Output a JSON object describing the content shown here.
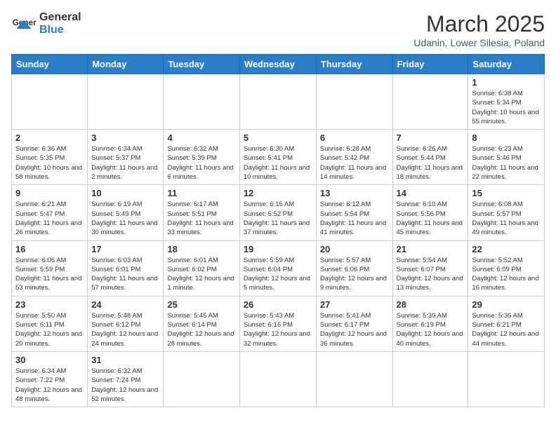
{
  "header": {
    "logo_general": "General",
    "logo_blue": "Blue",
    "month_title": "March 2025",
    "subtitle": "Udanin, Lower Silesia, Poland"
  },
  "weekdays": [
    "Sunday",
    "Monday",
    "Tuesday",
    "Wednesday",
    "Thursday",
    "Friday",
    "Saturday"
  ],
  "weeks": [
    [
      {
        "day": "",
        "info": ""
      },
      {
        "day": "",
        "info": ""
      },
      {
        "day": "",
        "info": ""
      },
      {
        "day": "",
        "info": ""
      },
      {
        "day": "",
        "info": ""
      },
      {
        "day": "",
        "info": ""
      },
      {
        "day": "1",
        "info": "Sunrise: 6:38 AM\nSunset: 5:34 PM\nDaylight: 10 hours and 55 minutes."
      }
    ],
    [
      {
        "day": "2",
        "info": "Sunrise: 6:36 AM\nSunset: 5:35 PM\nDaylight: 10 hours and 58 minutes."
      },
      {
        "day": "3",
        "info": "Sunrise: 6:34 AM\nSunset: 5:37 PM\nDaylight: 11 hours and 2 minutes."
      },
      {
        "day": "4",
        "info": "Sunrise: 6:32 AM\nSunset: 5:39 PM\nDaylight: 11 hours and 6 minutes."
      },
      {
        "day": "5",
        "info": "Sunrise: 6:30 AM\nSunset: 5:41 PM\nDaylight: 11 hours and 10 minutes."
      },
      {
        "day": "6",
        "info": "Sunrise: 6:28 AM\nSunset: 5:42 PM\nDaylight: 11 hours and 14 minutes."
      },
      {
        "day": "7",
        "info": "Sunrise: 6:26 AM\nSunset: 5:44 PM\nDaylight: 11 hours and 18 minutes."
      },
      {
        "day": "8",
        "info": "Sunrise: 6:23 AM\nSunset: 5:46 PM\nDaylight: 11 hours and 22 minutes."
      }
    ],
    [
      {
        "day": "9",
        "info": "Sunrise: 6:21 AM\nSunset: 5:47 PM\nDaylight: 11 hours and 26 minutes."
      },
      {
        "day": "10",
        "info": "Sunrise: 6:19 AM\nSunset: 5:49 PM\nDaylight: 11 hours and 30 minutes."
      },
      {
        "day": "11",
        "info": "Sunrise: 6:17 AM\nSunset: 5:51 PM\nDaylight: 11 hours and 33 minutes."
      },
      {
        "day": "12",
        "info": "Sunrise: 6:15 AM\nSunset: 5:52 PM\nDaylight: 11 hours and 37 minutes."
      },
      {
        "day": "13",
        "info": "Sunrise: 6:12 AM\nSunset: 5:54 PM\nDaylight: 11 hours and 41 minutes."
      },
      {
        "day": "14",
        "info": "Sunrise: 6:10 AM\nSunset: 5:56 PM\nDaylight: 11 hours and 45 minutes."
      },
      {
        "day": "15",
        "info": "Sunrise: 6:08 AM\nSunset: 5:57 PM\nDaylight: 11 hours and 49 minutes."
      }
    ],
    [
      {
        "day": "16",
        "info": "Sunrise: 6:06 AM\nSunset: 5:59 PM\nDaylight: 11 hours and 53 minutes."
      },
      {
        "day": "17",
        "info": "Sunrise: 6:03 AM\nSunset: 6:01 PM\nDaylight: 11 hours and 57 minutes."
      },
      {
        "day": "18",
        "info": "Sunrise: 6:01 AM\nSunset: 6:02 PM\nDaylight: 12 hours and 1 minute."
      },
      {
        "day": "19",
        "info": "Sunrise: 5:59 AM\nSunset: 6:04 PM\nDaylight: 12 hours and 5 minutes."
      },
      {
        "day": "20",
        "info": "Sunrise: 5:57 AM\nSunset: 6:06 PM\nDaylight: 12 hours and 9 minutes."
      },
      {
        "day": "21",
        "info": "Sunrise: 5:54 AM\nSunset: 6:07 PM\nDaylight: 12 hours and 13 minutes."
      },
      {
        "day": "22",
        "info": "Sunrise: 5:52 AM\nSunset: 6:09 PM\nDaylight: 12 hours and 16 minutes."
      }
    ],
    [
      {
        "day": "23",
        "info": "Sunrise: 5:50 AM\nSunset: 6:11 PM\nDaylight: 12 hours and 20 minutes."
      },
      {
        "day": "24",
        "info": "Sunrise: 5:48 AM\nSunset: 6:12 PM\nDaylight: 12 hours and 24 minutes."
      },
      {
        "day": "25",
        "info": "Sunrise: 5:45 AM\nSunset: 6:14 PM\nDaylight: 12 hours and 28 minutes."
      },
      {
        "day": "26",
        "info": "Sunrise: 5:43 AM\nSunset: 6:16 PM\nDaylight: 12 hours and 32 minutes."
      },
      {
        "day": "27",
        "info": "Sunrise: 5:41 AM\nSunset: 6:17 PM\nDaylight: 12 hours and 36 minutes."
      },
      {
        "day": "28",
        "info": "Sunrise: 5:39 AM\nSunset: 6:19 PM\nDaylight: 12 hours and 40 minutes."
      },
      {
        "day": "29",
        "info": "Sunrise: 5:36 AM\nSunset: 6:21 PM\nDaylight: 12 hours and 44 minutes."
      }
    ],
    [
      {
        "day": "30",
        "info": "Sunrise: 6:34 AM\nSunset: 7:22 PM\nDaylight: 12 hours and 48 minutes."
      },
      {
        "day": "31",
        "info": "Sunrise: 6:32 AM\nSunset: 7:24 PM\nDaylight: 12 hours and 52 minutes."
      },
      {
        "day": "",
        "info": ""
      },
      {
        "day": "",
        "info": ""
      },
      {
        "day": "",
        "info": ""
      },
      {
        "day": "",
        "info": ""
      },
      {
        "day": "",
        "info": ""
      }
    ]
  ]
}
